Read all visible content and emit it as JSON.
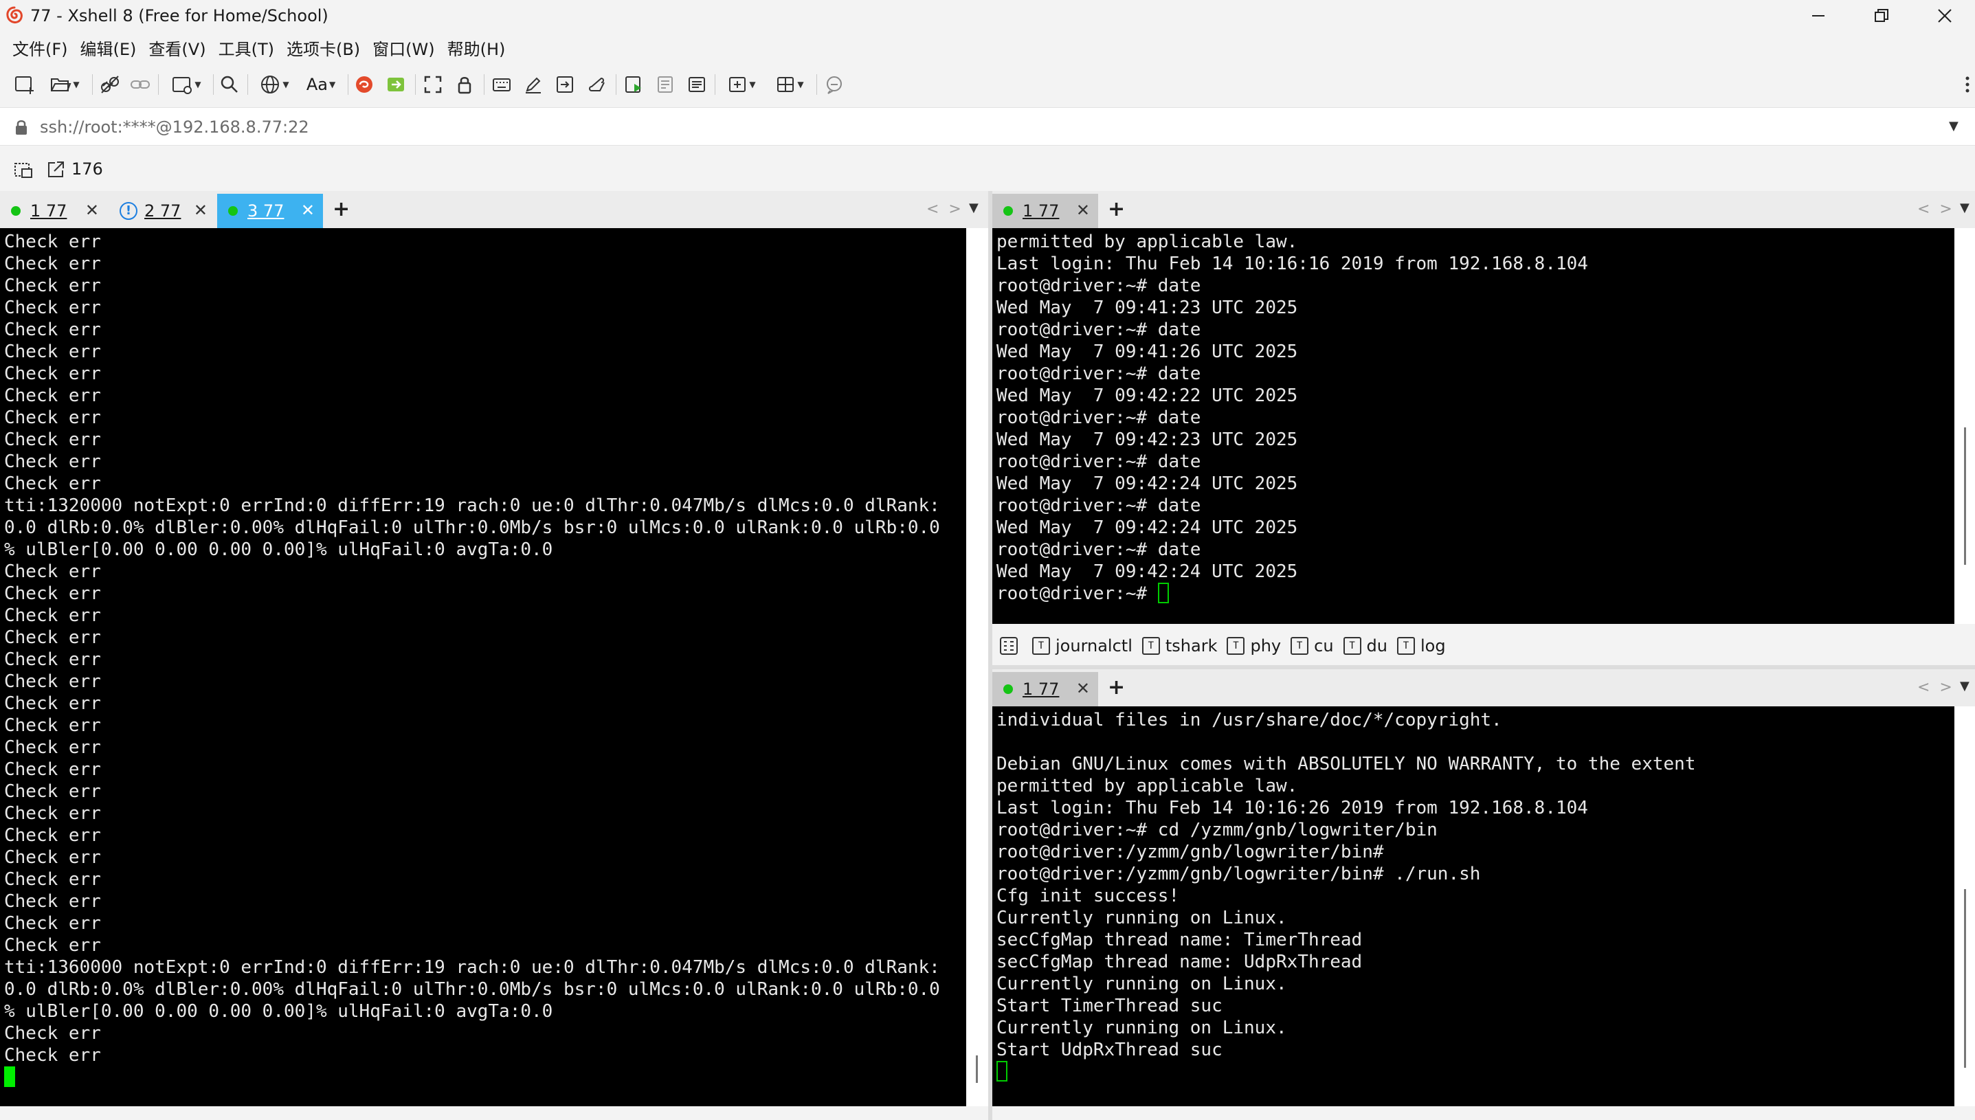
{
  "window": {
    "title": "77 - Xshell 8 (Free for Home/School)"
  },
  "menu": [
    "文件(F)",
    "编辑(E)",
    "查看(V)",
    "工具(T)",
    "选项卡(B)",
    "窗口(W)",
    "帮助(H)"
  ],
  "toolbar": {
    "font_label": "Aa"
  },
  "address": {
    "text": "ssh://root:****@192.168.8.77:22"
  },
  "session_bar": {
    "count": "176"
  },
  "left_pane": {
    "tabs": [
      {
        "label": "1 77",
        "status": "connected"
      },
      {
        "label": "2 77",
        "status": "warning"
      },
      {
        "label": "3 77",
        "status": "connected",
        "active": true
      }
    ],
    "add_label": "+",
    "lines": [
      "Check err",
      "Check err",
      "Check err",
      "Check err",
      "Check err",
      "Check err",
      "Check err",
      "Check err",
      "Check err",
      "Check err",
      "Check err",
      "Check err",
      "tti:1320000 notExpt:0 errInd:0 diffErr:19 rach:0 ue:0 dlThr:0.047Mb/s dlMcs:0.0 dlRank:",
      "0.0 dlRb:0.0% dlBler:0.00% dlHqFail:0 ulThr:0.0Mb/s bsr:0 ulMcs:0.0 ulRank:0.0 ulRb:0.0",
      "% ulBler[0.00 0.00 0.00 0.00]% ulHqFail:0 avgTa:0.0",
      "Check err",
      "Check err",
      "Check err",
      "Check err",
      "Check err",
      "Check err",
      "Check err",
      "Check err",
      "Check err",
      "Check err",
      "Check err",
      "Check err",
      "Check err",
      "Check err",
      "Check err",
      "Check err",
      "Check err",
      "Check err",
      "tti:1360000 notExpt:0 errInd:0 diffErr:19 rach:0 ue:0 dlThr:0.047Mb/s dlMcs:0.0 dlRank:",
      "0.0 dlRb:0.0% dlBler:0.00% dlHqFail:0 ulThr:0.0Mb/s bsr:0 ulMcs:0.0 ulRank:0.0 ulRb:0.0",
      "% ulBler[0.00 0.00 0.00 0.00]% ulHqFail:0 avgTa:0.0",
      "Check err",
      "Check err"
    ]
  },
  "right_top_pane": {
    "tab": {
      "label": "1 77",
      "status": "connected"
    },
    "add_label": "+",
    "lines": [
      "permitted by applicable law.",
      "Last login: Thu Feb 14 10:16:16 2019 from 192.168.8.104",
      "root@driver:~# date",
      "Wed May  7 09:41:23 UTC 2025",
      "root@driver:~# date",
      "Wed May  7 09:41:26 UTC 2025",
      "root@driver:~# date",
      "Wed May  7 09:42:22 UTC 2025",
      "root@driver:~# date",
      "Wed May  7 09:42:23 UTC 2025",
      "root@driver:~# date",
      "Wed May  7 09:42:24 UTC 2025",
      "root@driver:~# date",
      "Wed May  7 09:42:24 UTC 2025",
      "root@driver:~# date",
      "Wed May  7 09:42:24 UTC 2025"
    ],
    "prompt": "root@driver:~# "
  },
  "quick_commands": [
    "journalctl",
    "tshark",
    "phy",
    "cu",
    "du",
    "log"
  ],
  "right_bottom_pane": {
    "tab": {
      "label": "1 77",
      "status": "connected"
    },
    "add_label": "+",
    "lines": [
      "individual files in /usr/share/doc/*/copyright.",
      "",
      "Debian GNU/Linux comes with ABSOLUTELY NO WARRANTY, to the extent",
      "permitted by applicable law.",
      "Last login: Thu Feb 14 10:16:26 2019 from 192.168.8.104",
      "root@driver:~# cd /yzmm/gnb/logwriter/bin",
      "root@driver:/yzmm/gnb/logwriter/bin#",
      "root@driver:/yzmm/gnb/logwriter/bin# ./run.sh",
      "Cfg init success!",
      "Currently running on Linux.",
      "secCfgMap thread name: TimerThread",
      "secCfgMap thread name: UdpRxThread",
      "Currently running on Linux.",
      "Start TimerThread suc",
      "Currently running on Linux.",
      "Start UdpRxThread suc"
    ]
  },
  "colors": {
    "active_tab": "#3db2f0",
    "status_dot": "#15c415",
    "cursor": "#00ee00",
    "terminal_bg": "#000000"
  }
}
